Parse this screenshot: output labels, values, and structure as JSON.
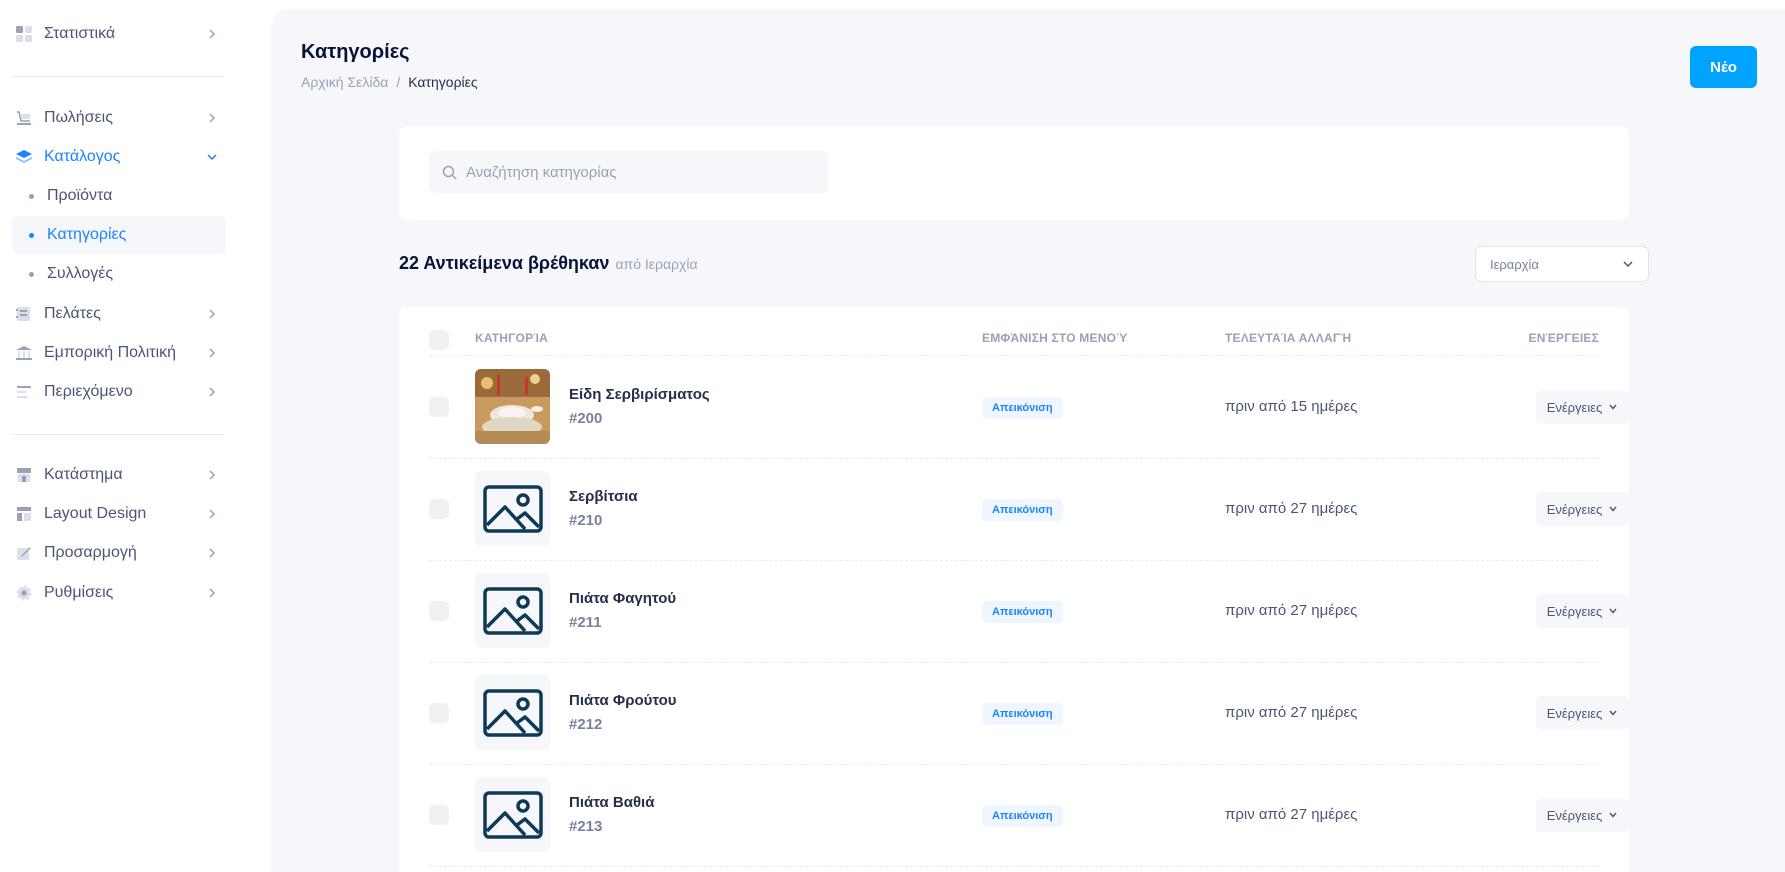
{
  "sidebar": {
    "items": [
      {
        "label": "Στατιστικά",
        "icon": "chart-grid-icon"
      },
      {
        "label": "Πωλήσεις",
        "icon": "cart-icon"
      },
      {
        "label": "Κατάλογος",
        "icon": "layers-icon"
      },
      {
        "label": "Πελάτες",
        "icon": "address-book-icon"
      },
      {
        "label": "Εμπορική Πολιτική",
        "icon": "bank-icon"
      },
      {
        "label": "Περιεχόμενο",
        "icon": "text-align-icon"
      },
      {
        "label": "Κατάστημα",
        "icon": "store-icon"
      },
      {
        "label": "Layout Design",
        "icon": "layout-icon"
      },
      {
        "label": "Προσαρμογή",
        "icon": "pencil-icon"
      },
      {
        "label": "Ρυθμίσεις",
        "icon": "gear-icon"
      }
    ],
    "catalog_sub": [
      {
        "label": "Προϊόντα"
      },
      {
        "label": "Κατηγορίες"
      },
      {
        "label": "Συλλογές"
      }
    ]
  },
  "header": {
    "title": "Κατηγορίες",
    "breadcrumb_home": "Αρχική Σελίδα",
    "breadcrumb_sep": "/",
    "breadcrumb_current": "Κατηγορίες",
    "new_label": "Νέο"
  },
  "search": {
    "placeholder": "Αναζήτηση κατηγορίας"
  },
  "results": {
    "count_label": "22 Αντικείμενα βρέθηκαν",
    "by_label": "από Ιεραρχία",
    "sort_value": "Ιεραρχία"
  },
  "table": {
    "columns": [
      "Κατηγορία",
      "Εμφάνιση στο Μενού",
      "Τελευταία αλλαγή",
      "Ενέργειες"
    ],
    "rows": [
      {
        "name": "Είδη Σερβιρίσματος",
        "id": "#200",
        "status": "Απεικόνιση",
        "changed": "πριν από 15 ημέρες",
        "action": "Ενέργειες",
        "thumb": "photo"
      },
      {
        "name": "Σερβίτσια",
        "id": "#210",
        "status": "Απεικόνιση",
        "changed": "πριν από 27 ημέρες",
        "action": "Ενέργειες",
        "thumb": "placeholder"
      },
      {
        "name": "Πιάτα Φαγητού",
        "id": "#211",
        "status": "Απεικόνιση",
        "changed": "πριν από 27 ημέρες",
        "action": "Ενέργειες",
        "thumb": "placeholder"
      },
      {
        "name": "Πιάτα Φρούτου",
        "id": "#212",
        "status": "Απεικόνιση",
        "changed": "πριν από 27 ημέρες",
        "action": "Ενέργειες",
        "thumb": "placeholder"
      },
      {
        "name": "Πιάτα Βαθιά",
        "id": "#213",
        "status": "Απεικόνιση",
        "changed": "πριν από 27 ημέρες",
        "action": "Ενέργειες",
        "thumb": "placeholder"
      }
    ]
  },
  "colors": {
    "accent": "#1b84ff",
    "primary_button": "#00a3ff",
    "background": "#f5f7fa",
    "placeholder_icon": "#0e3a56"
  }
}
